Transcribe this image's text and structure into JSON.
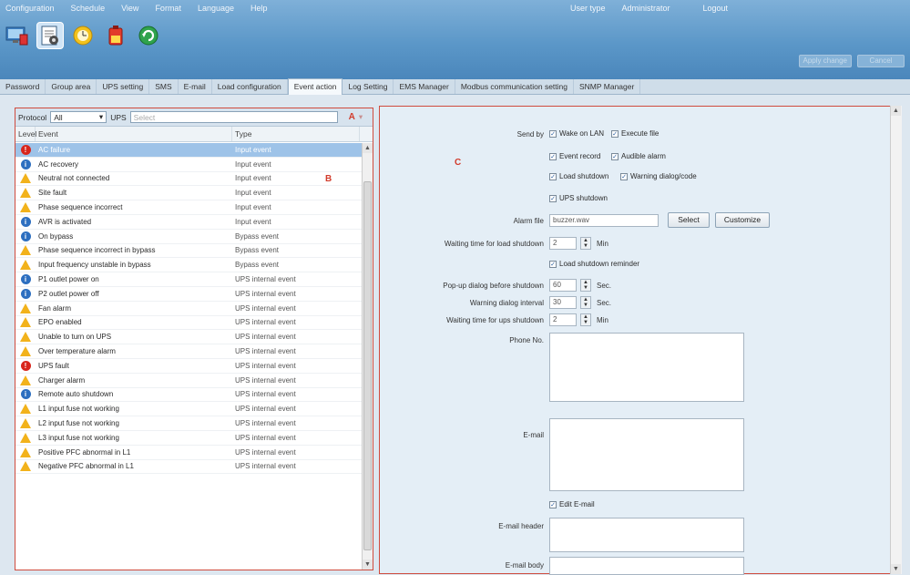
{
  "menu": {
    "items": [
      "Configuration",
      "Schedule",
      "View",
      "Format",
      "Language",
      "Help"
    ]
  },
  "user": {
    "type_label": "User type",
    "type_value": "Administrator",
    "logout": "Logout"
  },
  "header_buttons": [
    "Apply change",
    "Cancel"
  ],
  "tabs": [
    "Password",
    "Group area",
    "UPS setting",
    "SMS",
    "E-mail",
    "Load configuration",
    "Event action",
    "Log Setting",
    "EMS Manager",
    "Modbus communication setting",
    "SNMP Manager"
  ],
  "filter": {
    "protocol_label": "Protocol",
    "protocol_value": "All",
    "ups_label": "UPS",
    "ups_value": "Select",
    "annotation": "A"
  },
  "grid": {
    "col_level": "Level",
    "col_event": "Event",
    "col_type": "Type",
    "annotation": "B",
    "rows": [
      {
        "level": "error",
        "event": "AC failure",
        "type": "Input event"
      },
      {
        "level": "info",
        "event": "AC recovery",
        "type": "Input event"
      },
      {
        "level": "warn",
        "event": "Neutral not connected",
        "type": "Input event"
      },
      {
        "level": "warn",
        "event": "Site fault",
        "type": "Input event"
      },
      {
        "level": "warn",
        "event": "Phase sequence incorrect",
        "type": "Input event"
      },
      {
        "level": "info",
        "event": "AVR is activated",
        "type": "Input event"
      },
      {
        "level": "info",
        "event": "On bypass",
        "type": "Bypass event"
      },
      {
        "level": "warn",
        "event": "Phase sequence incorrect in bypass",
        "type": "Bypass event"
      },
      {
        "level": "warn",
        "event": "Input frequency unstable in bypass",
        "type": "Bypass event"
      },
      {
        "level": "info",
        "event": "P1 outlet power on",
        "type": "UPS internal event"
      },
      {
        "level": "info",
        "event": "P2 outlet power off",
        "type": "UPS internal event"
      },
      {
        "level": "warn",
        "event": "Fan alarm",
        "type": "UPS internal event"
      },
      {
        "level": "warn",
        "event": "EPO enabled",
        "type": "UPS internal event"
      },
      {
        "level": "warn",
        "event": "Unable to turn on UPS",
        "type": "UPS internal event"
      },
      {
        "level": "warn",
        "event": "Over temperature alarm",
        "type": "UPS internal event"
      },
      {
        "level": "error",
        "event": "UPS fault",
        "type": "UPS internal event"
      },
      {
        "level": "warn",
        "event": "Charger alarm",
        "type": "UPS internal event"
      },
      {
        "level": "info",
        "event": "Remote auto shutdown",
        "type": "UPS internal event"
      },
      {
        "level": "warn",
        "event": "L1 input fuse not working",
        "type": "UPS internal event"
      },
      {
        "level": "warn",
        "event": "L2 input fuse not working",
        "type": "UPS internal event"
      },
      {
        "level": "warn",
        "event": "L3 input fuse not working",
        "type": "UPS internal event"
      },
      {
        "level": "warn",
        "event": "Positive PFC abnormal in L1",
        "type": "UPS internal event"
      },
      {
        "level": "warn",
        "event": "Negative PFC abnormal in L1",
        "type": "UPS internal event"
      }
    ]
  },
  "action": {
    "annotation": "C",
    "send_by_label": "Send by",
    "cb_wake_on_lan": "Wake on LAN",
    "cb_execute_file": "Execute file",
    "cb_event_record": "Event record",
    "cb_audible_alarm": "Audible alarm",
    "cb_load_shutdown": "Load shutdown",
    "cb_warning_dialog": "Warning dialog/code",
    "cb_ups_shutdown": "UPS shutdown",
    "alarm_file_label": "Alarm file",
    "alarm_file_value": "buzzer.wav",
    "select_btn": "Select",
    "customize_btn": "Customize",
    "wait_load_label": "Waiting time for load shutdown",
    "wait_load_value": "2",
    "min_unit": "Min",
    "cb_load_reminder": "Load shutdown reminder",
    "popup_label": "Pop-up dialog before shutdown",
    "popup_value": "60",
    "sec_unit": "Sec.",
    "warn_interval_label": "Warning dialog interval",
    "warn_interval_value": "30",
    "wait_ups_label": "Waiting time for ups shutdown",
    "wait_ups_value": "2",
    "phone_label": "Phone No.",
    "email_label": "E-mail",
    "cb_edit_email": "Edit E-mail",
    "email_header_label": "E-mail header",
    "email_body_label": "E-mail body"
  }
}
